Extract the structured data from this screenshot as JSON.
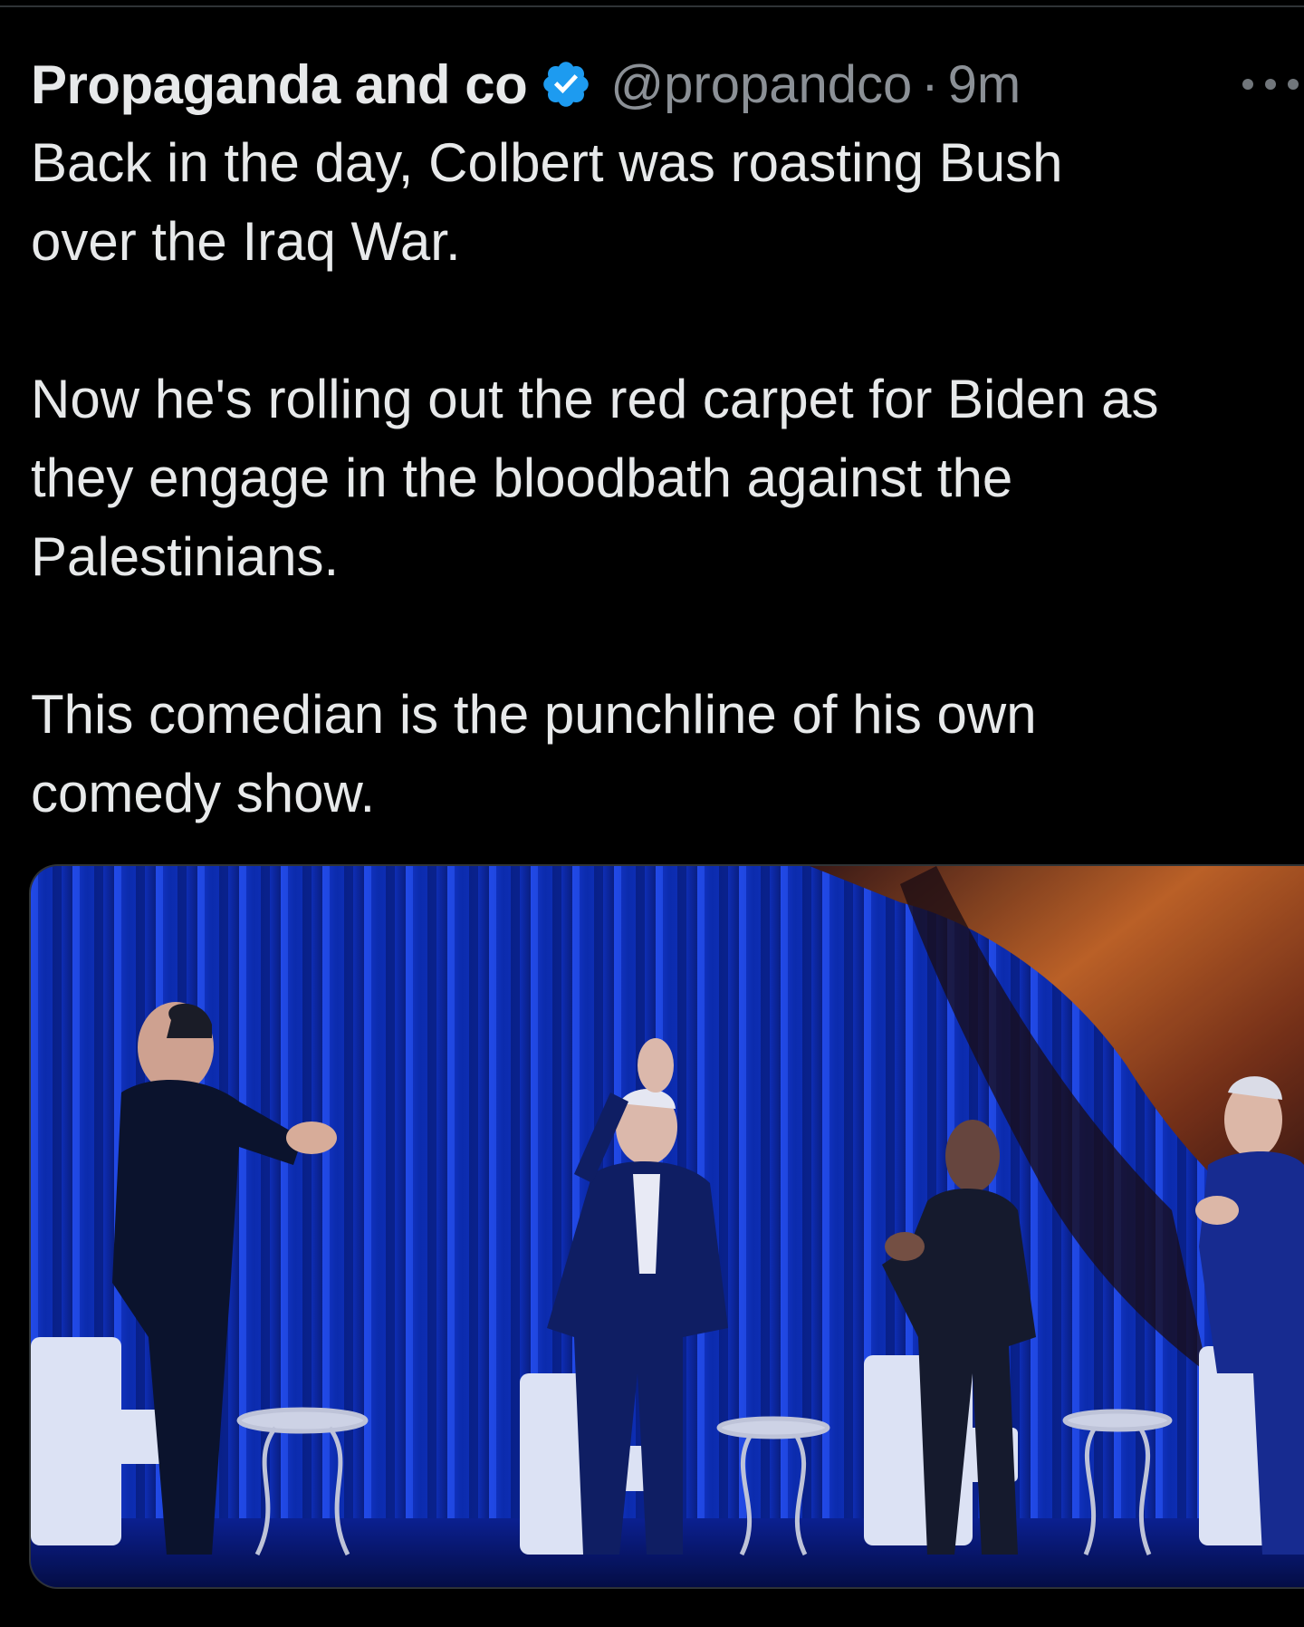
{
  "tweet": {
    "display_name": "Propaganda and co",
    "handle": "@propandco",
    "separator": "·",
    "timestamp": "9m",
    "lines": [
      "Back in the day, Colbert was roasting Bush",
      "over the Iraq War.",
      "",
      "Now he's rolling out the red carpet for Biden as",
      "they engage in the bloodbath against the",
      "Palestinians.",
      "",
      "This comedian is the punchline of his own",
      "comedy show."
    ]
  },
  "icons": {
    "verified": "verified-badge-icon",
    "more": "more-horizontal-icon"
  },
  "colors": {
    "background": "#000000",
    "text": "#e7e9ea",
    "secondary_text": "#8b9096",
    "verified_blue": "#1d9bf0",
    "curtain_blue": "#0b2fb8",
    "curtain_orange": "#b8560f"
  }
}
